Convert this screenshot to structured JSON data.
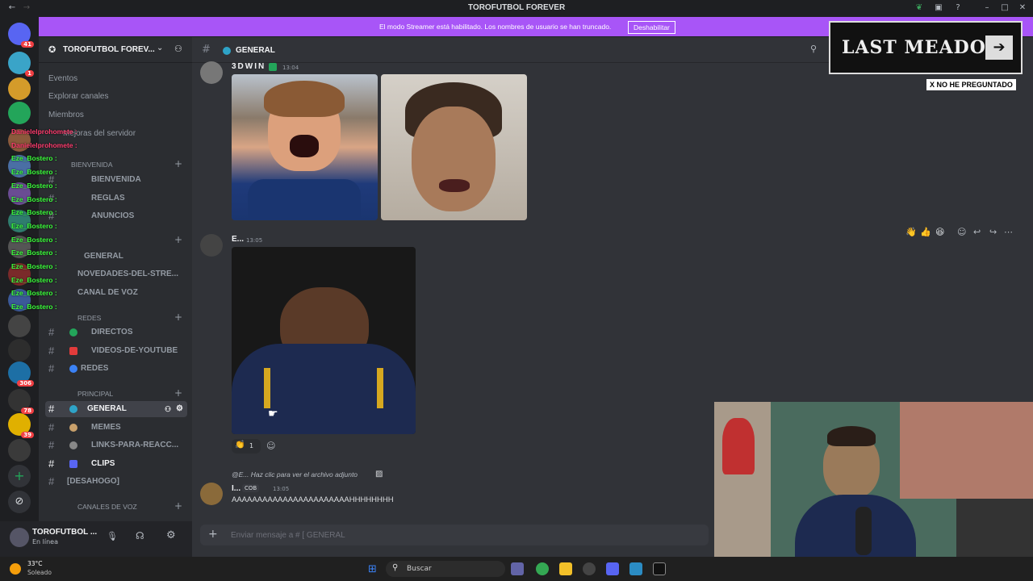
{
  "window": {
    "title": "TOROFUTBOL FOREVER"
  },
  "streamer_banner": {
    "message": "El modo Streamer está habilitado. Los nombres de usuario se han truncado.",
    "button": "Deshabilitar"
  },
  "server": {
    "name": "TOROFUTBOL FOREV...",
    "menu": [
      "Eventos",
      "Explorar canales",
      "Miembros",
      "Mejoras del servidor"
    ]
  },
  "categories": {
    "bienvenida": "BIENVENIDA",
    "redes": "REDES",
    "principal": "PRINCIPAL",
    "voz": "CANALES DE VOZ"
  },
  "channels": {
    "bienvenida": "BIENVENIDA",
    "reglas": "REGLAS",
    "anuncios": "ANUNCIOS",
    "general_voice": "GENERAL",
    "novedades": "NOVEDADES-DEL-STRE...",
    "canal_voz": "CANAL DE VOZ",
    "directos": "DIRECTOS",
    "videos": "VIDEOS-DE-YOUTUBE",
    "redes": "REDES",
    "general": "GENERAL",
    "memes": "MEMES",
    "links": "LINKS-PARA-REACC...",
    "clips": "CLIPS",
    "desahogo": "[DESAHOGO]"
  },
  "chat_overlay": [
    {
      "user": "Danielelprohomete :",
      "alt": true
    },
    {
      "user": "Danielelprohomete :",
      "alt": true
    },
    {
      "user": "Eze_Bostero :"
    },
    {
      "user": "Eze_Bostero :"
    },
    {
      "user": "Eze_Bostero :"
    },
    {
      "user": "Eze_Bostero :"
    },
    {
      "user": "Eze_Bostero :"
    },
    {
      "user": "Eze_Bostero :"
    },
    {
      "user": "Eze_Bostero :"
    },
    {
      "user": "Eze_Bostero :"
    },
    {
      "user": "Eze_Bostero :"
    },
    {
      "user": "Eze_Bostero :"
    },
    {
      "user": "Eze_Bostero :"
    },
    {
      "user": "Eze_Bostero :"
    }
  ],
  "guild_badges": [
    "41",
    "1",
    "306",
    "78",
    "39"
  ],
  "user": {
    "name": "TOROFUTBOL ...",
    "status": "En línea"
  },
  "channel_header": {
    "name": "GENERAL"
  },
  "messages": {
    "m1": {
      "author": "3DWIN",
      "time": "13:04"
    },
    "m2": {
      "author": "E...",
      "time": "13:05",
      "reaction_count": "1"
    },
    "m3": {
      "reply": "@E... Haz clic para ver el archivo adjunto",
      "author": "I...",
      "tag": "COB",
      "time": "13:05",
      "text": "AAAAAAAAAAAAAAAAAAAAAAAHHHHHHHH"
    }
  },
  "composer": {
    "placeholder": "Enviar mensaje a # [ GENERAL"
  },
  "overlay": {
    "title": "LAST MEADOW",
    "tag": "X NO HE PREGUNTADO"
  },
  "taskbar": {
    "search": "Buscar",
    "weather_temp": "33°C",
    "weather_desc": "Soleado"
  }
}
